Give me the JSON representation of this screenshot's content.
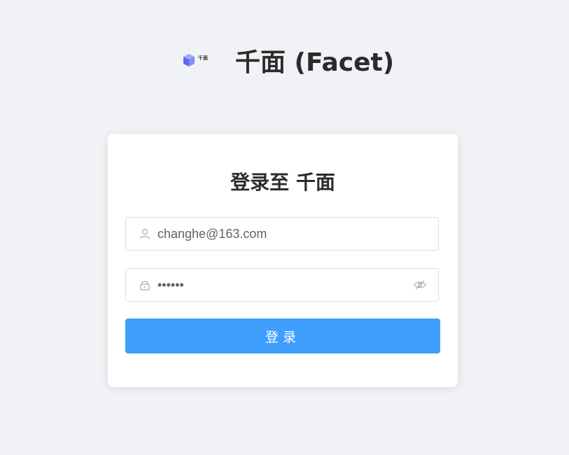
{
  "header": {
    "logo_text": "千面",
    "title": "千面 (Facet)"
  },
  "login": {
    "title": "登录至 千面",
    "username": {
      "value": "changhe@163.com",
      "placeholder": ""
    },
    "password": {
      "value": "123456",
      "placeholder": ""
    },
    "submit_label": "登录"
  },
  "icons": {
    "logo": "cube-logo-icon",
    "username_prefix": "user-icon",
    "password_prefix": "lock-icon",
    "password_toggle": "eye-off-icon"
  },
  "colors": {
    "background": "#f0f2f5",
    "primary": "#409eff",
    "logo_cube": "#6b7cff"
  }
}
